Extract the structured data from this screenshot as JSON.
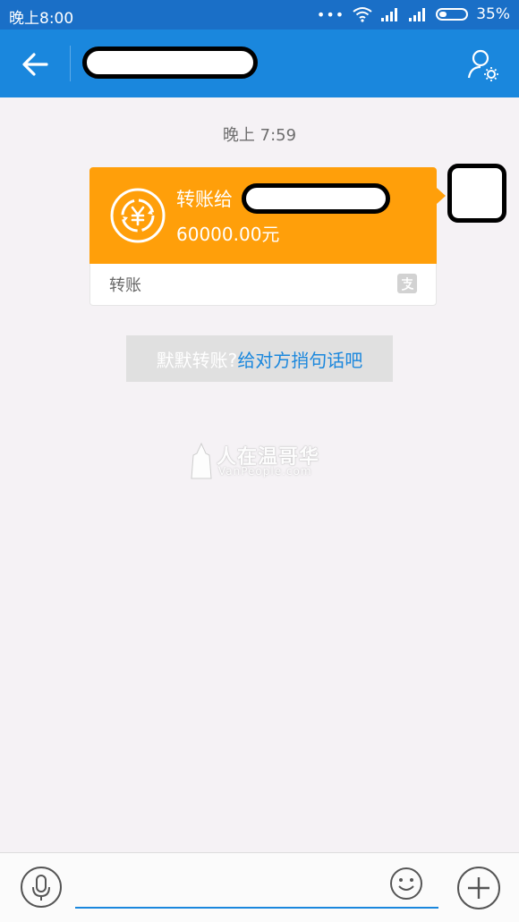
{
  "status_bar": {
    "time": "晚上8:00",
    "battery": "35%"
  },
  "header": {
    "back_icon": "back-arrow-icon",
    "profile_icon": "user-settings-icon"
  },
  "chat": {
    "timestamp": "晚上 7:59",
    "transfer": {
      "title": "转账给",
      "amount": "60000.00元",
      "type_label": "转账",
      "icon": "yuan-transfer-icon",
      "brand_icon": "alipay-icon"
    },
    "hint": {
      "static_text": "默默转账?",
      "link_text": "给对方捎句话吧"
    }
  },
  "watermark": {
    "title": "人在温哥华",
    "subtitle": "VanPeople.com"
  },
  "input_bar": {
    "voice_icon": "microphone-icon",
    "emoji_icon": "smiley-icon",
    "add_icon": "plus-icon",
    "placeholder": ""
  },
  "colors": {
    "status_bar": "#1a6fc7",
    "app_bar": "#1a87dd",
    "transfer_card": "#ff9f0a",
    "link": "#1a87dd"
  }
}
